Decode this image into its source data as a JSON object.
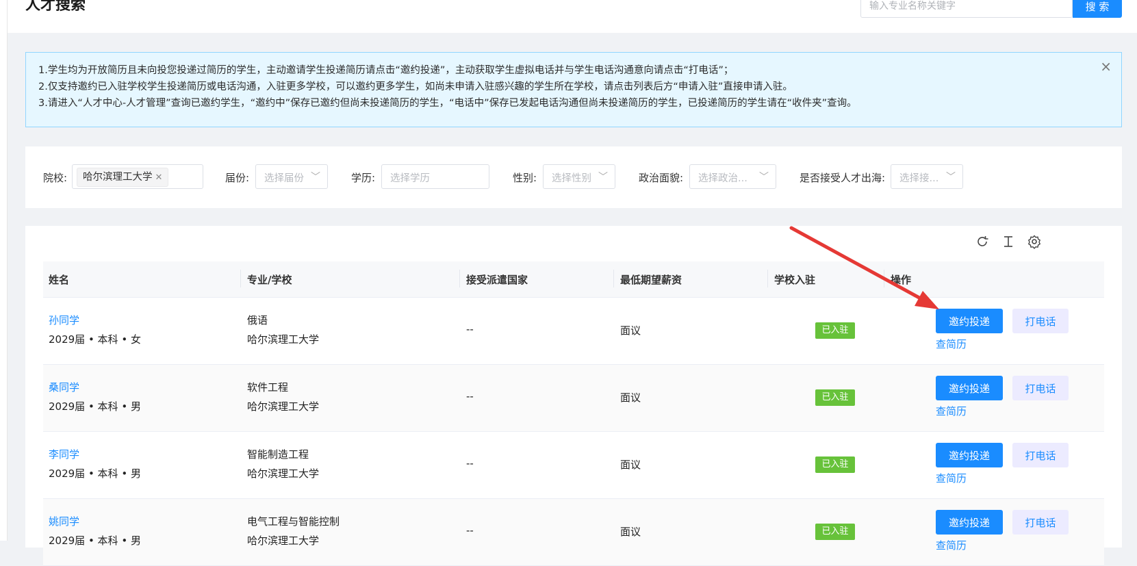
{
  "header": {
    "title": "人才搜索",
    "search_placeholder": "输入专业名称关键字",
    "search_button": "搜 索"
  },
  "notice": {
    "lines": [
      "1.学生均为开放简历且未向投您投递过简历的学生，主动邀请学生投递简历请点击“邀约投递”，主动获取学生虚拟电话并与学生电话沟通意向请点击“打电话”；",
      "2.仅支持邀约已入驻学校学生投递简历或电话沟通，入驻更多学校，可以邀约更多学生，如尚未申请入驻感兴趣的学生所在学校，请点击列表后方“申请入驻”直接申请入驻。",
      "3.请进入“人才中心-人才管理”查询已邀约学生，“邀约中”保存已邀约但尚未投递简历的学生，“电话中”保存已发起电话沟通但尚未投递简历的学生，已投递简历的学生请在“收件夹”查询。"
    ],
    "close_icon": "×"
  },
  "filters": {
    "school_label": "院校:",
    "school_tag": "哈尔滨理工大学",
    "grade_label": "届份:",
    "grade_placeholder": "选择届份",
    "edu_label": "学历:",
    "edu_placeholder": "选择学历",
    "gender_label": "性别:",
    "gender_placeholder": "选择性别",
    "politics_label": "政治面貌:",
    "politics_placeholder": "选择政治...",
    "overseas_label": "是否接受人才出海:",
    "overseas_placeholder": "选择接..."
  },
  "table": {
    "headers": {
      "name": "姓名",
      "major": "专业/学校",
      "country": "接受派遣国家",
      "salary": "最低期望薪资",
      "school_status": "学校入驻",
      "actions": "操作"
    },
    "rows": [
      {
        "name": "孙同学",
        "info": "2029届 • 本科 • 女",
        "major": "俄语",
        "school": "哈尔滨理工大学",
        "country": "--",
        "salary": "面议",
        "status": "已入驻",
        "invite": "邀约投递",
        "call": "打电话",
        "resume": "查简历"
      },
      {
        "name": "桑同学",
        "info": "2029届 • 本科 • 男",
        "major": "软件工程",
        "school": "哈尔滨理工大学",
        "country": "--",
        "salary": "面议",
        "status": "已入驻",
        "invite": "邀约投递",
        "call": "打电话",
        "resume": "查简历"
      },
      {
        "name": "李同学",
        "info": "2029届 • 本科 • 男",
        "major": "智能制造工程",
        "school": "哈尔滨理工大学",
        "country": "--",
        "salary": "面议",
        "status": "已入驻",
        "invite": "邀约投递",
        "call": "打电话",
        "resume": "查简历"
      },
      {
        "name": "姚同学",
        "info": "2029届 • 本科 • 男",
        "major": "电气工程与智能控制",
        "school": "哈尔滨理工大学",
        "country": "--",
        "salary": "面议",
        "status": "已入驻",
        "invite": "邀约投递",
        "call": "打电话",
        "resume": "查简历"
      }
    ]
  },
  "colors": {
    "primary": "#1a8cff",
    "badge_green": "#67c23a",
    "notice_bg": "#e6f7ff",
    "annotation_arrow": "#e53935"
  },
  "icons": {
    "refresh": "refresh-icon",
    "column_height": "column-height-icon",
    "settings": "settings-gear-icon",
    "close": "close-icon",
    "chevron": "chevron-down-icon"
  }
}
